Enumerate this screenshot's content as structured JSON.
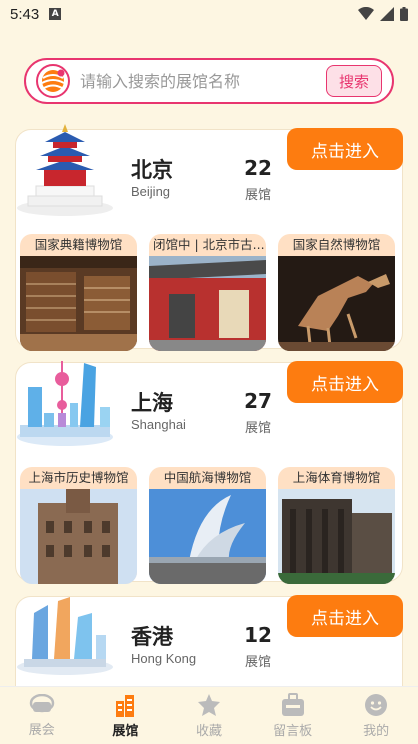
{
  "status_bar": {
    "time": "5:43",
    "notification_letter": "A"
  },
  "search": {
    "placeholder": "请输入搜索的展馆名称",
    "button_label": "搜索"
  },
  "cities": [
    {
      "name_cn": "北京",
      "name_en": "Beijing",
      "count": "22",
      "count_label": "展馆",
      "enter_label": "点击进入",
      "museums": [
        "国家典籍博物馆",
        "闭馆中 | 北京市古...",
        "国家自然博物馆"
      ]
    },
    {
      "name_cn": "上海",
      "name_en": "Shanghai",
      "count": "27",
      "count_label": "展馆",
      "enter_label": "点击进入",
      "museums": [
        "上海市历史博物馆",
        "中国航海博物馆",
        "上海体育博物馆"
      ]
    },
    {
      "name_cn": "香港",
      "name_en": "Hong Kong",
      "count": "12",
      "count_label": "展馆",
      "enter_label": "点击进入",
      "museums": []
    }
  ],
  "nav": [
    {
      "label": "展会",
      "icon": "exhibition-icon"
    },
    {
      "label": "展馆",
      "icon": "museum-icon"
    },
    {
      "label": "收藏",
      "icon": "star-icon"
    },
    {
      "label": "留言板",
      "icon": "message-board-icon"
    },
    {
      "label": "我的",
      "icon": "profile-icon"
    }
  ],
  "colors": {
    "accent": "#fd7c10",
    "search_border": "#e8356f",
    "background": "#fdf6e2"
  }
}
